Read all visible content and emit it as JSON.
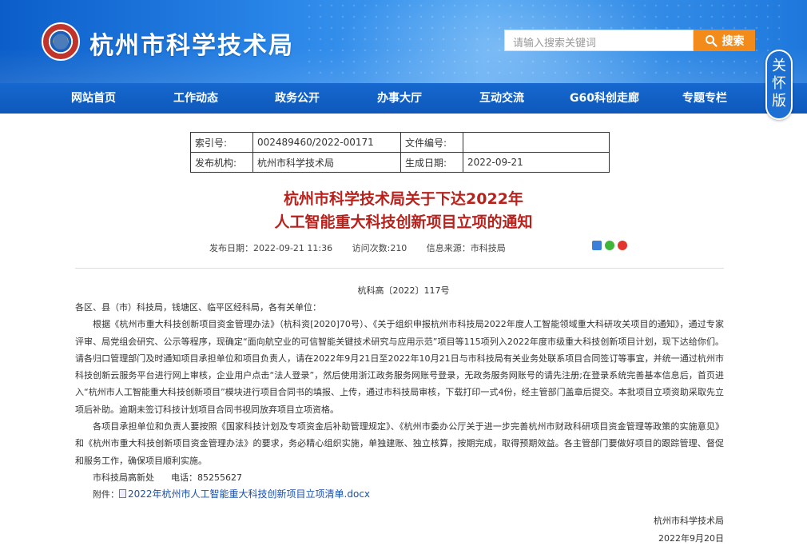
{
  "header": {
    "site_title": "杭州市科学技术局",
    "search_placeholder": "请输入搜索关键词",
    "search_button": "搜索",
    "care_version": [
      "关",
      "怀",
      "版"
    ]
  },
  "nav": {
    "items": [
      "网站首页",
      "工作动态",
      "政务公开",
      "办事大厅",
      "互动交流",
      "G60科创走廊",
      "专题专栏"
    ]
  },
  "meta": {
    "index_label": "索引号:",
    "index_value": "002489460/2022-00171",
    "docnum_label": "文件编号:",
    "docnum_value": "",
    "issuer_label": "发布机构:",
    "issuer_value": "杭州市科学技术局",
    "date_label": "生成日期:",
    "date_value": "2022-09-21"
  },
  "article": {
    "title_line1": "杭州市科学技术局关于下达2022年",
    "title_line2": "人工智能重大科技创新项目立项的通知",
    "publish_date": "发布日期：2022-09-21 11:36",
    "visits": "访问次数:210",
    "source": "信息来源：市科技局",
    "doc_number": "杭科高〔2022〕117号",
    "salutation": "各区、县（市）科技局，钱塘区、临平区经科局，各有关单位：",
    "para1": "根据《杭州市重大科技创新项目资金管理办法》（杭科资[2020]70号）、《关于组织申报杭州市科技局2022年度人工智能领域重大科研攻关项目的通知》，通过专家评审、局党组会研究、公示等程序，现确定“面向航空业的可信智能关键技术研究与应用示范”项目等115项列入2022年度市级重大科技创新项目计划，现下达给你们。请各归口管理部门及时通知项目承担单位和项目负责人，请在2022年9月21日至2022年10月21日与市科技局有关业务处联系项目合同签订等事宜，并统一通过杭州市科技创新云服务平台进行网上审核，企业用户点击“法人登录”，然后使用浙江政务服务网账号登录，无政务服务网账号的请先注册;在登录系统完善基本信息后，首页进入“杭州市人工智能重大科技创新项目”模块进行项目合同书的填报、上传，通过市科技局审核，下载打印一式4份，经主管部门盖章后提交。本批项目立项资助采取先立项后补助。逾期未签订科技计划项目合同书视同放弃项目立项资格。",
    "para2": "各项目承担单位和负责人要按照《国家科技计划及专项资金后补助管理规定》、《杭州市委办公厅关于进一步完善杭州市财政科研项目资金管理等政策的实施意见》和《杭州市重大科技创新项目资金管理办法》的要求，务必精心组织实施，单独建账、独立核算，按期完成，取得预期效益。各主管部门要做好项目的跟踪管理、督促和服务工作，确保项目顺利实施。",
    "contact": "市科技局高新处      电话：85255627",
    "attachment_label": "附件：",
    "attachment_link": "2022年杭州市人工智能重大科技创新项目立项清单.docx",
    "signer": "杭州市科学技术局",
    "sign_date": "2022年9月20日"
  },
  "colors": {
    "header_blue": "#1668cf",
    "title_red": "#b8211c",
    "search_orange": "#f28b1a"
  }
}
